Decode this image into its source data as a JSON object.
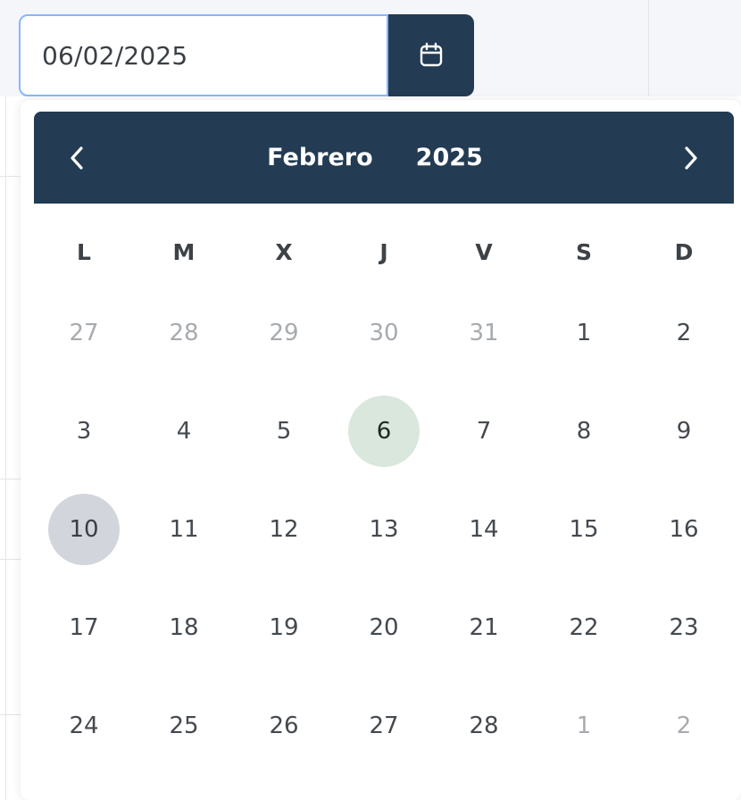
{
  "date_input": {
    "value": "06/02/2025",
    "button_icon": "calendar-icon"
  },
  "datepicker": {
    "month": "Febrero",
    "year": "2025",
    "prev_icon": "chevron-left-icon",
    "next_icon": "chevron-right-icon",
    "weekdays": [
      "L",
      "M",
      "X",
      "J",
      "V",
      "S",
      "D"
    ],
    "days": [
      {
        "label": "27",
        "state": "outside"
      },
      {
        "label": "28",
        "state": "outside"
      },
      {
        "label": "29",
        "state": "outside"
      },
      {
        "label": "30",
        "state": "outside"
      },
      {
        "label": "31",
        "state": "outside"
      },
      {
        "label": "1",
        "state": "normal"
      },
      {
        "label": "2",
        "state": "normal"
      },
      {
        "label": "3",
        "state": "normal"
      },
      {
        "label": "4",
        "state": "normal"
      },
      {
        "label": "5",
        "state": "normal"
      },
      {
        "label": "6",
        "state": "selected"
      },
      {
        "label": "7",
        "state": "normal"
      },
      {
        "label": "8",
        "state": "normal"
      },
      {
        "label": "9",
        "state": "normal"
      },
      {
        "label": "10",
        "state": "today"
      },
      {
        "label": "11",
        "state": "normal"
      },
      {
        "label": "12",
        "state": "normal"
      },
      {
        "label": "13",
        "state": "normal"
      },
      {
        "label": "14",
        "state": "normal"
      },
      {
        "label": "15",
        "state": "normal"
      },
      {
        "label": "16",
        "state": "normal"
      },
      {
        "label": "17",
        "state": "normal"
      },
      {
        "label": "18",
        "state": "normal"
      },
      {
        "label": "19",
        "state": "normal"
      },
      {
        "label": "20",
        "state": "normal"
      },
      {
        "label": "21",
        "state": "normal"
      },
      {
        "label": "22",
        "state": "normal"
      },
      {
        "label": "23",
        "state": "normal"
      },
      {
        "label": "24",
        "state": "normal"
      },
      {
        "label": "25",
        "state": "normal"
      },
      {
        "label": "26",
        "state": "normal"
      },
      {
        "label": "27",
        "state": "normal"
      },
      {
        "label": "28",
        "state": "normal"
      },
      {
        "label": "1",
        "state": "outside"
      },
      {
        "label": "2",
        "state": "outside"
      }
    ]
  },
  "colors": {
    "header_bg": "#233b53",
    "selected_bg": "#d9e7dc",
    "today_bg": "#d2d6dc",
    "input_focus_border": "#86b7fe"
  }
}
